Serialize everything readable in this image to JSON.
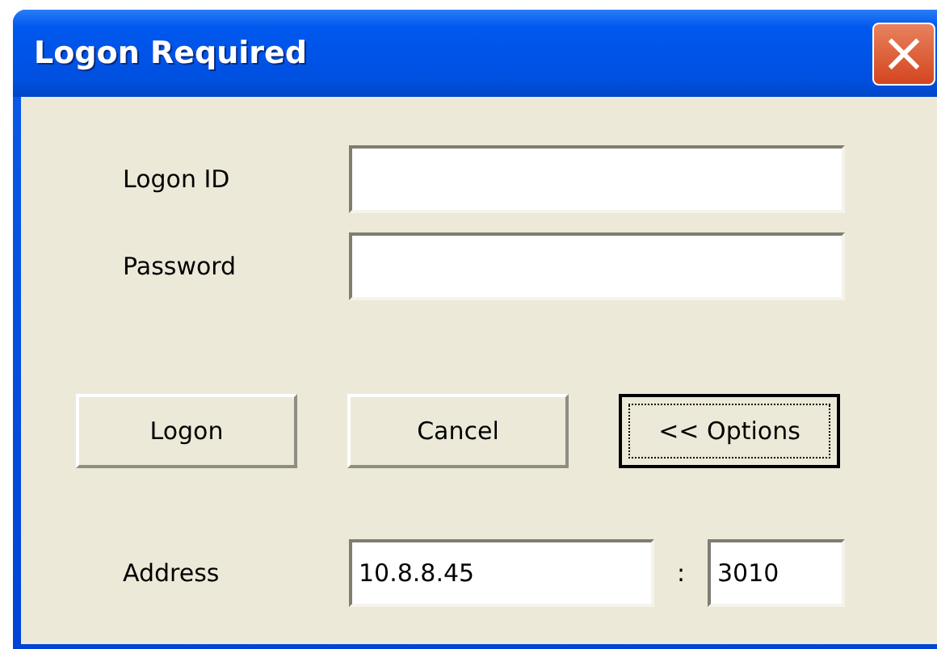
{
  "window": {
    "title": "Logon Required",
    "close": "×"
  },
  "fields": [
    {
      "label": "Logon ID"
    },
    {
      "label": "Password"
    }
  ],
  "buttons": [
    {
      "label": "Logon",
      "focused": false
    },
    {
      "label": "Cancel",
      "focused": false
    },
    {
      "label": "<< Options",
      "focused": true
    }
  ],
  "address": {
    "label": "Address",
    "host": "10.8.8.45",
    "separator": ":",
    "port": "3010"
  }
}
